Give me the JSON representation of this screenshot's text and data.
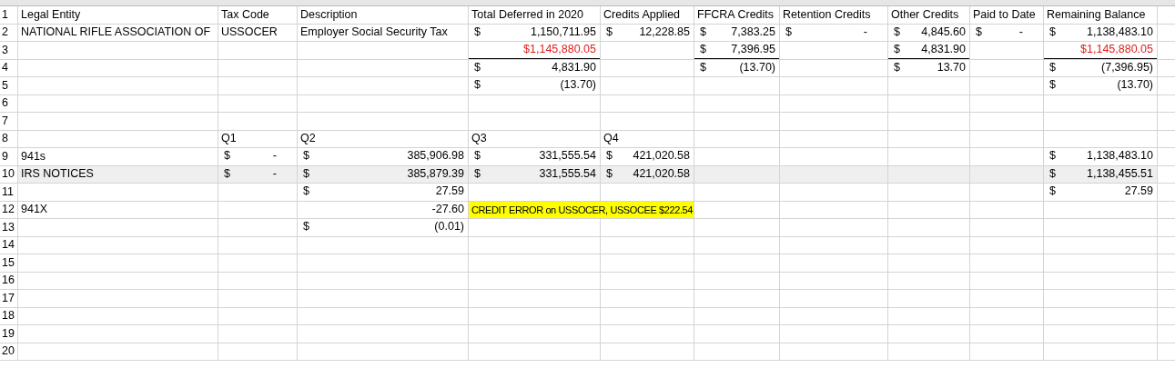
{
  "sheet": {
    "rows": [
      {
        "number": "1",
        "highlighted": false,
        "cells": [
          {
            "kind": "text",
            "text": "Legal Entity"
          },
          {
            "kind": "text",
            "text": "Tax Code"
          },
          {
            "kind": "text",
            "text": "Description"
          },
          {
            "kind": "text",
            "text": "Total Deferred in 2020"
          },
          {
            "kind": "text",
            "text": "Credits Applied"
          },
          {
            "kind": "text",
            "text": "FFCRA Credits"
          },
          {
            "kind": "text",
            "text": "Retention Credits"
          },
          {
            "kind": "text",
            "text": "Other Credits"
          },
          {
            "kind": "text",
            "text": "Paid to Date"
          },
          {
            "kind": "text",
            "text": "Remaining Balance"
          }
        ]
      },
      {
        "number": "2",
        "highlighted": false,
        "cells": [
          {
            "kind": "text",
            "text": "NATIONAL RIFLE ASSOCIATION OF"
          },
          {
            "kind": "text",
            "text": "USSOCER"
          },
          {
            "kind": "text",
            "text": "Employer Social Security Tax"
          },
          {
            "kind": "accounting",
            "symbol": "$",
            "amount": "1,150,711.95",
            "bottom_border": false
          },
          {
            "kind": "accounting",
            "symbol": "$",
            "amount": "12,228.85",
            "bottom_border": false
          },
          {
            "kind": "accounting",
            "symbol": "$",
            "amount": "7,383.25",
            "bottom_border": false
          },
          {
            "kind": "accounting_dash",
            "symbol": "$",
            "amount": "-",
            "bottom_border": false
          },
          {
            "kind": "accounting",
            "symbol": "$",
            "amount": "4,845.60",
            "bottom_border": false
          },
          {
            "kind": "accounting_dash",
            "symbol": "$",
            "amount": "-",
            "bottom_border": false
          },
          {
            "kind": "accounting",
            "symbol": "$",
            "amount": "1,138,483.10",
            "bottom_border": false
          }
        ]
      },
      {
        "number": "3",
        "highlighted": false,
        "cells": [
          null,
          null,
          null,
          {
            "kind": "number",
            "text": "$1,145,880.05",
            "red": true,
            "bottom_border": true
          },
          null,
          {
            "kind": "accounting",
            "symbol": "$",
            "amount": "7,396.95",
            "bottom_border": true
          },
          null,
          {
            "kind": "accounting",
            "symbol": "$",
            "amount": "4,831.90",
            "bottom_border": true
          },
          null,
          {
            "kind": "number",
            "text": "$1,145,880.05",
            "red": true,
            "bottom_border": true
          }
        ]
      },
      {
        "number": "4",
        "highlighted": false,
        "cells": [
          null,
          null,
          null,
          {
            "kind": "accounting",
            "symbol": "$",
            "amount": "4,831.90",
            "bottom_border": false
          },
          null,
          {
            "kind": "accounting",
            "symbol": "$",
            "amount": "(13.70)",
            "bottom_border": false
          },
          null,
          {
            "kind": "accounting",
            "symbol": "$",
            "amount": "13.70",
            "bottom_border": false
          },
          null,
          {
            "kind": "accounting",
            "symbol": "$",
            "amount": "(7,396.95)",
            "bottom_border": false
          }
        ]
      },
      {
        "number": "5",
        "highlighted": false,
        "cells": [
          null,
          null,
          null,
          {
            "kind": "accounting",
            "symbol": "$",
            "amount": "(13.70)",
            "bottom_border": false
          },
          null,
          null,
          null,
          null,
          null,
          {
            "kind": "accounting",
            "symbol": "$",
            "amount": "(13.70)",
            "bottom_border": false
          }
        ]
      },
      {
        "number": "6",
        "highlighted": false,
        "cells": []
      },
      {
        "number": "7",
        "highlighted": false,
        "cells": []
      },
      {
        "number": "8",
        "highlighted": false,
        "cells": [
          null,
          {
            "kind": "text",
            "text": "Q1"
          },
          {
            "kind": "text",
            "text": "Q2"
          },
          {
            "kind": "text",
            "text": "Q3"
          },
          {
            "kind": "text",
            "text": "Q4"
          }
        ]
      },
      {
        "number": "9",
        "highlighted": false,
        "cells": [
          {
            "kind": "text",
            "text": "941s"
          },
          {
            "kind": "accounting_dash",
            "symbol": "$",
            "amount": "-",
            "bottom_border": false
          },
          {
            "kind": "accounting",
            "symbol": "$",
            "amount": "385,906.98",
            "bottom_border": false
          },
          {
            "kind": "accounting",
            "symbol": "$",
            "amount": "331,555.54",
            "bottom_border": false
          },
          {
            "kind": "accounting",
            "symbol": "$",
            "amount": "421,020.58",
            "bottom_border": false
          },
          null,
          null,
          null,
          null,
          {
            "kind": "accounting",
            "symbol": "$",
            "amount": "1,138,483.10",
            "bottom_border": false
          }
        ]
      },
      {
        "number": "10",
        "highlighted": true,
        "cells": [
          {
            "kind": "text",
            "text": "IRS NOTICES"
          },
          {
            "kind": "accounting_dash",
            "symbol": "$",
            "amount": "-",
            "bottom_border": false
          },
          {
            "kind": "accounting",
            "symbol": "$",
            "amount": "385,879.39",
            "bottom_border": false
          },
          {
            "kind": "accounting",
            "symbol": "$",
            "amount": "331,555.54",
            "bottom_border": false
          },
          {
            "kind": "accounting",
            "symbol": "$",
            "amount": "421,020.58",
            "bottom_border": false
          },
          null,
          null,
          null,
          null,
          {
            "kind": "accounting",
            "symbol": "$",
            "amount": "1,138,455.51",
            "bottom_border": false
          }
        ]
      },
      {
        "number": "11",
        "highlighted": false,
        "cells": [
          null,
          null,
          {
            "kind": "accounting",
            "symbol": "$",
            "amount": "27.59",
            "bottom_border": false
          },
          null,
          null,
          null,
          null,
          null,
          null,
          {
            "kind": "accounting",
            "symbol": "$",
            "amount": "27.59",
            "bottom_border": false
          }
        ]
      },
      {
        "number": "12",
        "highlighted": false,
        "cells": [
          {
            "kind": "text",
            "text": "941X"
          },
          null,
          {
            "kind": "number",
            "text": "-27.60",
            "red": false,
            "bottom_border": false
          },
          {
            "kind": "note",
            "text": "CREDIT ERROR on USSOCER, USSOCEE $222.54"
          }
        ]
      },
      {
        "number": "13",
        "highlighted": false,
        "cells": [
          null,
          null,
          {
            "kind": "accounting",
            "symbol": "$",
            "amount": "(0.01)",
            "bottom_border": false
          }
        ]
      },
      {
        "number": "14",
        "highlighted": false,
        "cells": []
      },
      {
        "number": "15",
        "highlighted": false,
        "cells": []
      },
      {
        "number": "16",
        "highlighted": false,
        "cells": []
      },
      {
        "number": "17",
        "highlighted": false,
        "cells": []
      },
      {
        "number": "18",
        "highlighted": false,
        "cells": []
      },
      {
        "number": "19",
        "highlighted": false,
        "cells": []
      },
      {
        "number": "20",
        "highlighted": false,
        "cells": []
      }
    ]
  }
}
